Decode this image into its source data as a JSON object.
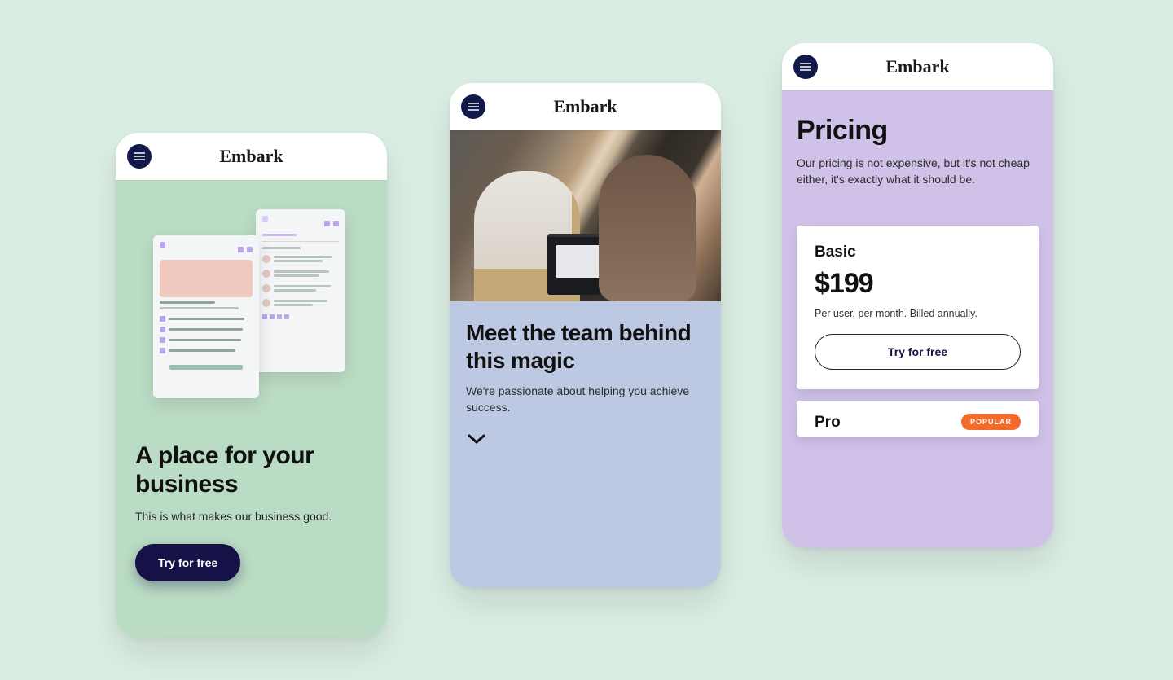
{
  "brand": "Embark",
  "screens": {
    "home": {
      "headline": "A place for your business",
      "subtitle": "This is what makes our business good.",
      "cta": "Try for free"
    },
    "team": {
      "headline": "Meet the team behind this magic",
      "subtitle": "We're passionate about helping you achieve success."
    },
    "pricing": {
      "title": "Pricing",
      "subtitle": "Our pricing is not expensive, but it's not cheap either, it's exactly what it should be.",
      "plans": [
        {
          "name": "Basic",
          "price": "$199",
          "terms": "Per user, per month. Billed annually.",
          "cta": "Try for free"
        },
        {
          "name": "Pro",
          "badge": "POPULAR"
        }
      ]
    }
  }
}
